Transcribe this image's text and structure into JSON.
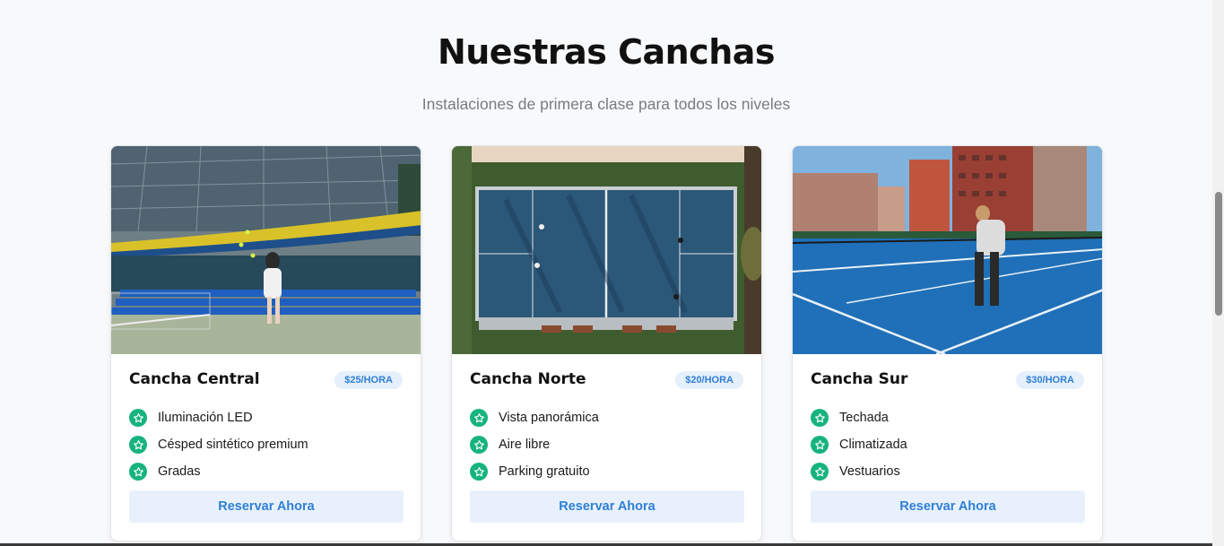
{
  "section": {
    "title": "Nuestras Canchas",
    "subtitle": "Instalaciones de primera clase para todos los niveles"
  },
  "courts": [
    {
      "name": "Cancha Central",
      "price": "$25/HORA",
      "features": [
        "Iluminación LED",
        "Césped sintético premium",
        "Gradas"
      ],
      "button": "Reservar Ahora",
      "photo": "indoor-tennis-court-photo"
    },
    {
      "name": "Cancha Norte",
      "price": "$20/HORA",
      "features": [
        "Vista panorámica",
        "Aire libre",
        "Parking gratuito"
      ],
      "button": "Reservar Ahora",
      "photo": "aerial-padel-court-photo"
    },
    {
      "name": "Cancha Sur",
      "price": "$30/HORA",
      "features": [
        "Techada",
        "Climatizada",
        "Vestuarios"
      ],
      "button": "Reservar Ahora",
      "photo": "outdoor-blue-court-photo"
    }
  ],
  "colors": {
    "accent": "#2f7fd6",
    "badge_bg": "#e6f0fb",
    "feature_icon": "#17b37e",
    "button_bg": "#e8f1fb"
  }
}
